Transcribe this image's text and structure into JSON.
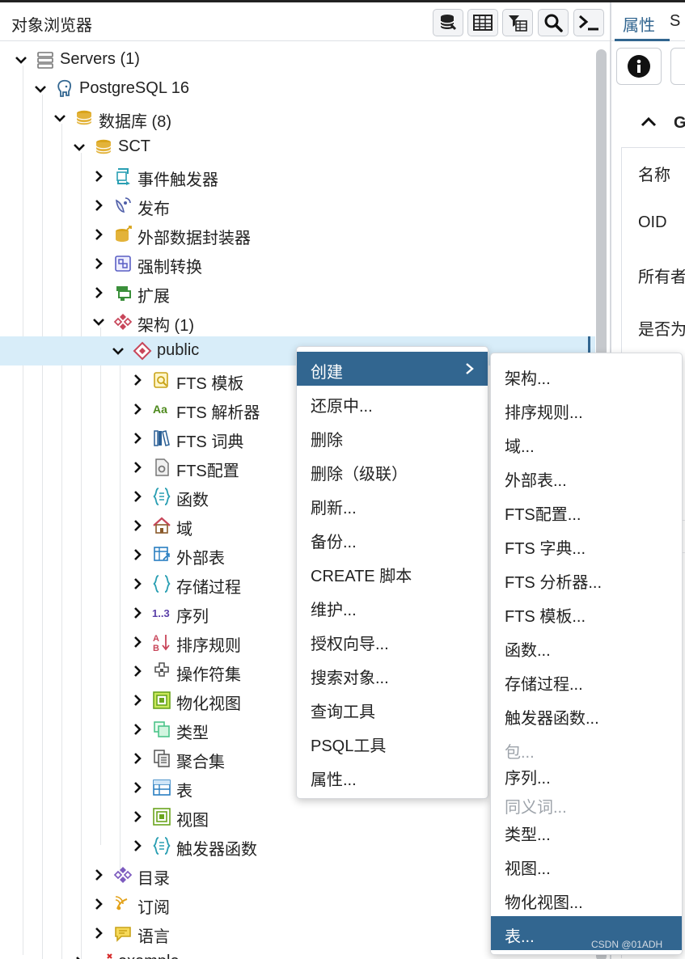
{
  "browser": {
    "title": "对象浏览器",
    "toolbar": [
      {
        "name": "database-icon",
        "label": "query tool"
      },
      {
        "name": "table-view-icon"
      },
      {
        "name": "filter-rows-icon"
      },
      {
        "name": "search-icon"
      },
      {
        "name": "psql-terminal-icon"
      }
    ]
  },
  "tree": [
    {
      "label": "Servers (1)",
      "icon": "servers-icon",
      "level": 0,
      "expanded": true
    },
    {
      "label": "PostgreSQL 16",
      "icon": "postgresql-elephant-icon",
      "level": 1,
      "expanded": true
    },
    {
      "label": "数据库 (8)",
      "icon": "databases-icon",
      "level": 2,
      "expanded": true
    },
    {
      "label": "SCT",
      "icon": "database-icon",
      "level": 3,
      "expanded": true
    },
    {
      "label": "事件触发器",
      "icon": "event-trigger-icon",
      "level": 4,
      "expanded": false
    },
    {
      "label": "发布",
      "icon": "publication-icon",
      "level": 4,
      "expanded": false
    },
    {
      "label": "外部数据封装器",
      "icon": "foreign-data-wrapper-icon",
      "level": 4,
      "expanded": false
    },
    {
      "label": "强制转换",
      "icon": "cast-icon",
      "level": 4,
      "expanded": false
    },
    {
      "label": "扩展",
      "icon": "extension-icon",
      "level": 4,
      "expanded": false
    },
    {
      "label": "架构 (1)",
      "icon": "schemas-icon",
      "level": 4,
      "expanded": true
    },
    {
      "label": "public",
      "icon": "schema-icon",
      "level": 5,
      "expanded": true,
      "selected": true
    },
    {
      "label": "FTS 模板",
      "icon": "fts-template-icon",
      "level": 6,
      "expanded": false
    },
    {
      "label": "FTS 解析器",
      "icon": "fts-parser-icon",
      "level": 6,
      "expanded": false
    },
    {
      "label": "FTS 词典",
      "icon": "fts-dictionary-icon",
      "level": 6,
      "expanded": false
    },
    {
      "label": "FTS配置",
      "icon": "fts-configuration-icon",
      "level": 6,
      "expanded": false
    },
    {
      "label": "函数",
      "icon": "function-icon",
      "level": 6,
      "expanded": false
    },
    {
      "label": "域",
      "icon": "domain-icon",
      "level": 6,
      "expanded": false
    },
    {
      "label": "外部表",
      "icon": "foreign-table-icon",
      "level": 6,
      "expanded": false
    },
    {
      "label": "存储过程",
      "icon": "procedure-icon",
      "level": 6,
      "expanded": false
    },
    {
      "label": "序列",
      "icon": "sequence-icon",
      "level": 6,
      "expanded": false
    },
    {
      "label": "排序规则",
      "icon": "collation-icon",
      "level": 6,
      "expanded": false
    },
    {
      "label": "操作符集",
      "icon": "operator-icon",
      "level": 6,
      "expanded": false
    },
    {
      "label": "物化视图",
      "icon": "materialized-view-icon",
      "level": 6,
      "expanded": false
    },
    {
      "label": "类型",
      "icon": "type-icon",
      "level": 6,
      "expanded": false
    },
    {
      "label": "聚合集",
      "icon": "aggregate-icon",
      "level": 6,
      "expanded": false
    },
    {
      "label": "表",
      "icon": "table-icon",
      "level": 6,
      "expanded": false
    },
    {
      "label": "视图",
      "icon": "view-icon",
      "level": 6,
      "expanded": false
    },
    {
      "label": "触发器函数",
      "icon": "trigger-function-icon",
      "level": 6,
      "expanded": false
    },
    {
      "label": "目录",
      "icon": "catalog-icon",
      "level": 4,
      "expanded": false
    },
    {
      "label": "订阅",
      "icon": "subscription-icon",
      "level": 4,
      "expanded": false
    },
    {
      "label": "语言",
      "icon": "language-icon",
      "level": 4,
      "expanded": false
    },
    {
      "label": "example",
      "icon": "database-disconnected-icon",
      "level": 3,
      "expanded": false
    }
  ],
  "context_menu": [
    {
      "label": "创建",
      "has_submenu": true,
      "active": true
    },
    {
      "label": "还原中..."
    },
    {
      "label": "删除"
    },
    {
      "label": "删除（级联）"
    },
    {
      "label": "刷新..."
    },
    {
      "label": "备份..."
    },
    {
      "label": "CREATE 脚本"
    },
    {
      "label": "维护..."
    },
    {
      "label": "授权向导..."
    },
    {
      "label": "搜索对象..."
    },
    {
      "label": "查询工具"
    },
    {
      "label": "PSQL工具"
    },
    {
      "label": "属性..."
    }
  ],
  "submenu": [
    {
      "label": "架构..."
    },
    {
      "label": "排序规则..."
    },
    {
      "label": "域..."
    },
    {
      "label": "外部表..."
    },
    {
      "label": "FTS配置..."
    },
    {
      "label": "FTS 字典..."
    },
    {
      "label": "FTS 分析器..."
    },
    {
      "label": "FTS 模板..."
    },
    {
      "label": "函数..."
    },
    {
      "label": "存储过程..."
    },
    {
      "label": "触发器函数..."
    },
    {
      "label": "包...",
      "disabled": true
    },
    {
      "label": "序列..."
    },
    {
      "label": "同义词...",
      "disabled": true
    },
    {
      "label": "类型..."
    },
    {
      "label": "视图..."
    },
    {
      "label": "物化视图..."
    },
    {
      "label": "表...",
      "active": true
    }
  ],
  "properties": {
    "active_tab": "属性",
    "next_tab": "S",
    "group_label": "G",
    "rows": [
      "名称",
      "OID",
      "所有者",
      "是否为"
    ]
  },
  "watermark": "CSDN @01ADH",
  "colors": {
    "accent": "#326690",
    "selected_row": "#d8edf9"
  }
}
